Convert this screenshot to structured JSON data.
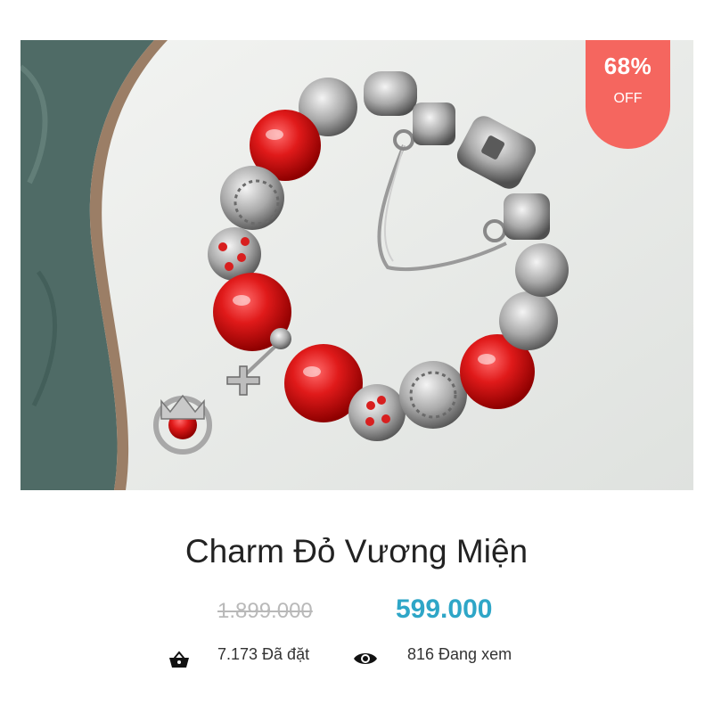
{
  "badge": {
    "percent": "68%",
    "label": "OFF"
  },
  "product": {
    "title": "Charm Đỏ Vương Miện",
    "original_price": "1.899.000",
    "sale_price": "599.000"
  },
  "stats": {
    "orders": {
      "icon": "basket-icon",
      "text": "7.173 Đã đặt"
    },
    "viewers": {
      "icon": "eye-icon",
      "text": "816 Đang xem"
    }
  },
  "colors": {
    "badge_bg": "#f5665f",
    "sale_price": "#2ea6c7",
    "original_price": "#b9b9b9",
    "bead_red": "#d81f1f"
  }
}
